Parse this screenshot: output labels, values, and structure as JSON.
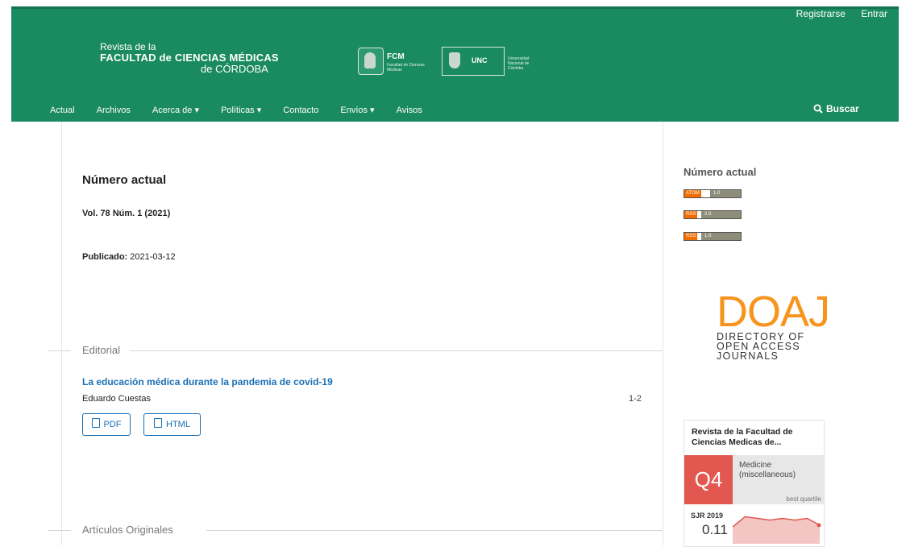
{
  "header": {
    "user_links": [
      "Registrarse",
      "Entrar"
    ],
    "title_line1": "Revista de la",
    "title_line2": "FACULTAD de CIENCIAS MÉDICAS",
    "title_line3": "de CÓRDOBA",
    "fcm_label": "FCM",
    "fcm_sub": "Facultad de Ciencias Médicas",
    "unc_label": "UNC",
    "unc_sub": "Universidad Nacional de Córdoba",
    "accent_color": "#1a8a61"
  },
  "nav": {
    "items": [
      "Actual",
      "Archivos",
      "Acerca de ▾",
      "Políticas ▾",
      "Contacto",
      "Envíos ▾",
      "Avisos"
    ],
    "search_label": "Buscar"
  },
  "issue": {
    "heading": "Número actual",
    "volume": "Vol. 78 Núm. 1 (2021)",
    "published_label": "Publicado:",
    "published_date": "2021-03-12"
  },
  "sections": [
    {
      "title": "Editorial",
      "article": {
        "title": "La educación médica durante la pandemia de covid-19",
        "author": "Eduardo Cuestas",
        "pages": "1-2",
        "galleys": [
          "PDF",
          "HTML"
        ]
      }
    },
    {
      "title": "Artículos Originales"
    }
  ],
  "sidebar": {
    "title": "Número actual",
    "feeds": [
      {
        "left": "ATOM",
        "right": "1.0"
      },
      {
        "left": "RSS",
        "right": "2.0"
      },
      {
        "left": "RSS",
        "right": "1.0"
      }
    ],
    "doaj": {
      "big": "DOAJ",
      "line1": "DIRECTORY OF",
      "line2": "OPEN ACCESS",
      "line3": "JOURNALS"
    },
    "sjr": {
      "journal": "Revista de la Facultad de Ciencias Medicas de...",
      "quartile": "Q4",
      "category": "Medicine (miscellaneous)",
      "best_quartile": "best quartile",
      "label": "SJR 2019",
      "value": "0.11",
      "trend": [
        0.1,
        0.16,
        0.15,
        0.14,
        0.15,
        0.14,
        0.15,
        0.11
      ]
    }
  }
}
